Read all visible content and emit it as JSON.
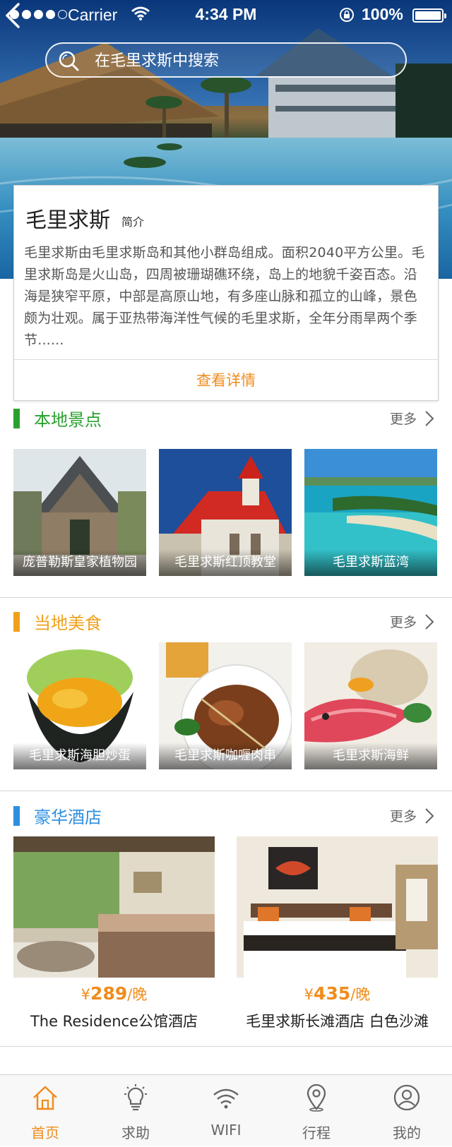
{
  "status_bar": {
    "carrier": "Carrier",
    "time": "4:34 PM",
    "battery": "100%"
  },
  "search": {
    "placeholder": "在毛里求斯中搜索"
  },
  "intro": {
    "title": "毛里求斯",
    "subtitle": "简介",
    "text": "毛里求斯由毛里求斯岛和其他小群岛组成。面积2040平方公里。毛里求斯岛是火山岛，四周被珊瑚礁环绕，岛上的地貌千姿百态。沿海是狭窄平原，中部是高原山地，有多座山脉和孤立的山峰，景色颇为壮观。属于亚热带海洋性气候的毛里求斯，全年分雨旱两个季节......",
    "detail_label": "查看详情"
  },
  "attractions": {
    "title": "本地景点",
    "color": "#2aa12f",
    "more": "更多",
    "items": [
      {
        "name": "庞普勒斯皇家植物园"
      },
      {
        "name": "毛里求斯红顶教堂"
      },
      {
        "name": "毛里求斯蓝湾"
      }
    ]
  },
  "food": {
    "title": "当地美食",
    "color": "#f0a11c",
    "more": "更多",
    "items": [
      {
        "name": "毛里求斯海胆炒蛋"
      },
      {
        "name": "毛里求斯咖喱肉串"
      },
      {
        "name": "毛里求斯海鲜"
      }
    ]
  },
  "hotels": {
    "title": "豪华酒店",
    "color": "#2e8fe0",
    "more": "更多",
    "items": [
      {
        "currency": "¥",
        "price": "289",
        "unit": "/晚",
        "name": "The Residence公馆酒店"
      },
      {
        "currency": "¥",
        "price": "435",
        "unit": "/晚",
        "name": "毛里求斯长滩酒店 白色沙滩"
      }
    ]
  },
  "tabbar": {
    "active_color": "#f08c1c",
    "items": [
      {
        "label": "首页",
        "icon": "home-icon",
        "active": true
      },
      {
        "label": "求助",
        "icon": "lightbulb-icon",
        "active": false
      },
      {
        "label": "WIFI",
        "icon": "wifi-icon",
        "active": false
      },
      {
        "label": "行程",
        "icon": "location-pin-icon",
        "active": false
      },
      {
        "label": "我的",
        "icon": "user-icon",
        "active": false
      }
    ]
  }
}
